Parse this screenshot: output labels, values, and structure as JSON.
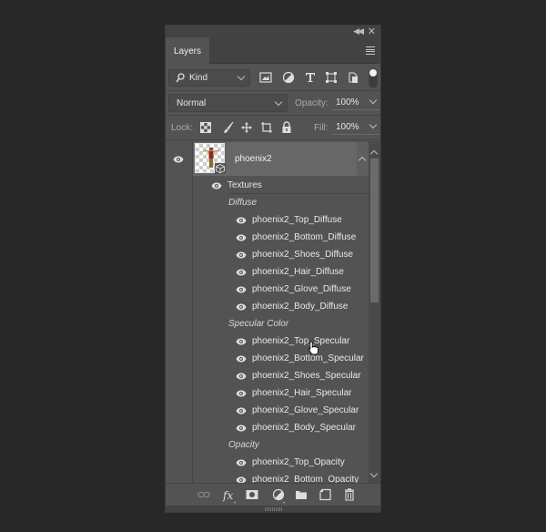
{
  "panel": {
    "tab_label": "Layers",
    "filter": {
      "kind_label": "Kind"
    },
    "blend": {
      "mode": "Normal",
      "opacity_label": "Opacity:",
      "opacity_value": "100%"
    },
    "lock": {
      "label": "Lock:",
      "fill_label": "Fill:",
      "fill_value": "100%"
    },
    "layer": {
      "name": "phoenix2"
    },
    "textures_label": "Textures",
    "groups": [
      {
        "label": "Diffuse",
        "items": [
          "phoenix2_Top_Diffuse",
          "phoenix2_Bottom_Diffuse",
          "phoenix2_Shoes_Diffuse",
          "phoenix2_Hair_Diffuse",
          "phoenix2_Glove_Diffuse",
          "phoenix2_Body_Diffuse"
        ]
      },
      {
        "label": "Specular Color",
        "items": [
          "phoenix2_Top_Specular",
          "phoenix2_Bottom_Specular",
          "phoenix2_Shoes_Specular",
          "phoenix2_Hair_Specular",
          "phoenix2_Glove_Specular",
          "phoenix2_Body_Specular"
        ]
      },
      {
        "label": "Opacity",
        "items": [
          "phoenix2_Top_Opacity",
          "phoenix2_Bottom_Opacity"
        ]
      }
    ],
    "scroll_position": 0.0
  }
}
